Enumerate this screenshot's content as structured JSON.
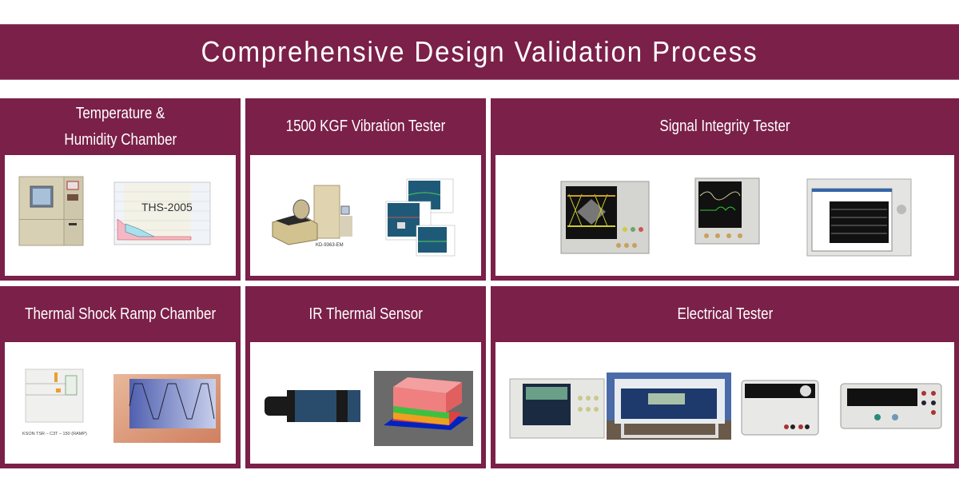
{
  "title": "Comprehensive Design Validation Process",
  "colors": {
    "brand": "#7b2049",
    "panel_bg": "#ffffff",
    "text": "#ffffff"
  },
  "panels": [
    {
      "title": "Temperature & Humidity Chamber",
      "title_lines": [
        "Temperature &",
        "Humidity Chamber"
      ],
      "images": [
        {
          "name": "temperature-humidity-chamber-photo",
          "caption": ""
        },
        {
          "name": "ths-chart",
          "caption": "THS-2005"
        }
      ]
    },
    {
      "title": "1500 KGF Vibration Tester",
      "images": [
        {
          "name": "vibration-tester-photo",
          "caption": "KD-9363-EM"
        },
        {
          "name": "vibration-analysis-screens",
          "caption": ""
        }
      ]
    },
    {
      "title": "Signal Integrity Tester",
      "images": [
        {
          "name": "eye-diagram-oscilloscope",
          "caption": ""
        },
        {
          "name": "digital-oscilloscope",
          "caption": ""
        },
        {
          "name": "logic-analyzer",
          "caption": ""
        }
      ]
    },
    {
      "title": "Thermal Shock Ramp Chamber",
      "images": [
        {
          "name": "thermal-shock-chamber-photo",
          "caption": "KSON TSR – C3T – 150 (RAMP)"
        },
        {
          "name": "temperature-cycle-chart",
          "caption": ""
        }
      ]
    },
    {
      "title": "IR Thermal Sensor",
      "images": [
        {
          "name": "ir-camera-photo",
          "caption": ""
        },
        {
          "name": "thermal-map-image",
          "caption": ""
        }
      ]
    },
    {
      "title": "Electrical Tester",
      "images": [
        {
          "name": "mixed-signal-oscilloscope",
          "caption": ""
        },
        {
          "name": "blue-bench-meter",
          "caption": ""
        },
        {
          "name": "dc-power-supply",
          "caption": ""
        },
        {
          "name": "digital-multimeter",
          "caption": ""
        }
      ]
    }
  ]
}
